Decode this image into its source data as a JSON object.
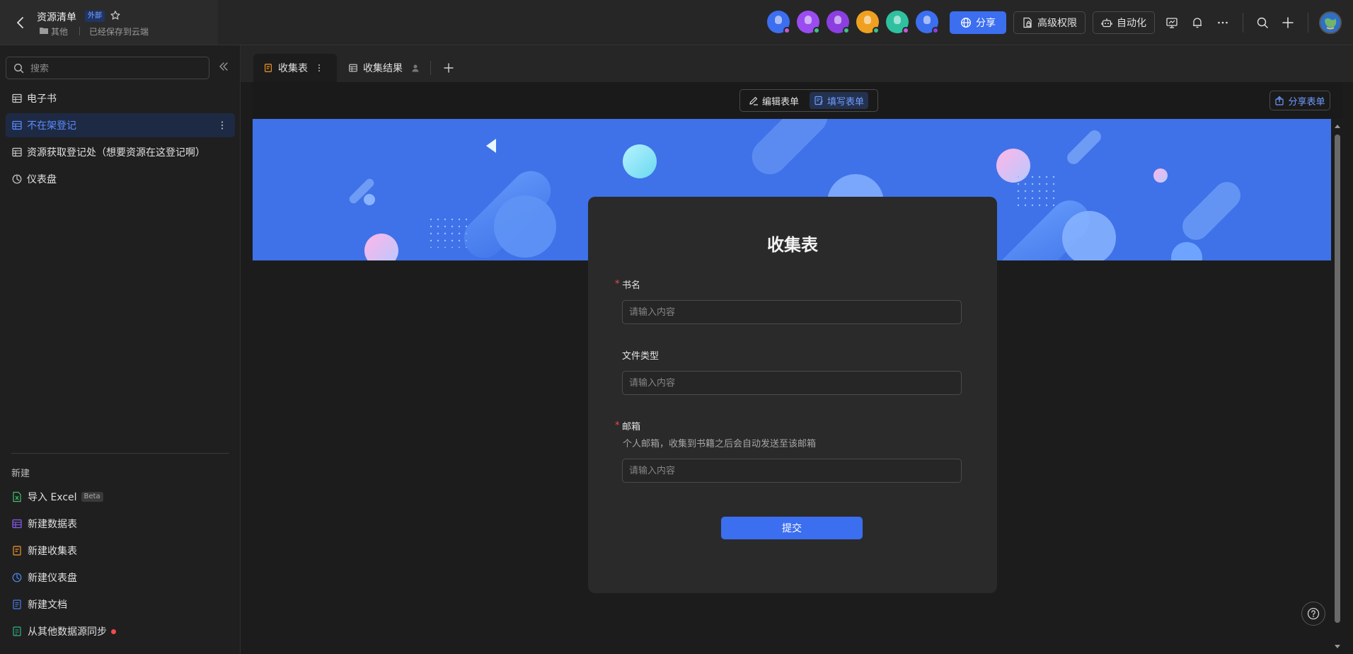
{
  "header": {
    "title": "资源清单",
    "badge": "外部",
    "folder": "其他",
    "save_status": "已经保存到云端",
    "share_label": "分享",
    "permission_label": "高级权限",
    "automation_label": "自动化"
  },
  "collaborators": [
    {
      "color": "#3c6ef0",
      "status": "#c45ad8"
    },
    {
      "color": "#9a4cf0",
      "status": "#3fbf8a"
    },
    {
      "color": "#8c3fe0",
      "status": "#3fbf8a"
    },
    {
      "color": "#f0a020",
      "status": "#3fbf8a"
    },
    {
      "color": "#2fc0a0",
      "status": "#c45ad8"
    },
    {
      "color": "#3c6ef0",
      "status": "#8c3fe0"
    }
  ],
  "sidebar": {
    "search_placeholder": "搜索",
    "items": [
      {
        "label": "电子书"
      },
      {
        "label": "不在架登记"
      },
      {
        "label": "资源获取登记处（想要资源在这登记啊）"
      },
      {
        "label": "仪表盘"
      }
    ],
    "new_section_label": "新建",
    "new_items": [
      {
        "label": "导入 Excel",
        "badge": "Beta"
      },
      {
        "label": "新建数据表"
      },
      {
        "label": "新建收集表"
      },
      {
        "label": "新建仪表盘"
      },
      {
        "label": "新建文档"
      },
      {
        "label": "从其他数据源同步"
      }
    ]
  },
  "tabs": [
    {
      "label": "收集表"
    },
    {
      "label": "收集结果"
    }
  ],
  "toolbar": {
    "edit_form_label": "编辑表单",
    "fill_form_label": "填写表单",
    "share_form_label": "分享表单"
  },
  "form": {
    "title": "收集表",
    "required_mark": "*",
    "fields": [
      {
        "label": "书名",
        "required": true,
        "placeholder": "请输入内容"
      },
      {
        "label": "文件类型",
        "required": false,
        "placeholder": "请输入内容"
      },
      {
        "label": "邮箱",
        "required": true,
        "description": "个人邮箱，收集到书籍之后会自动发送至该邮箱",
        "placeholder": "请输入内容"
      }
    ],
    "submit_label": "提交"
  },
  "colors": {
    "accent": "#3c6ef0",
    "banner": "#3f72e8",
    "active_nav_text": "#5b8cff"
  }
}
